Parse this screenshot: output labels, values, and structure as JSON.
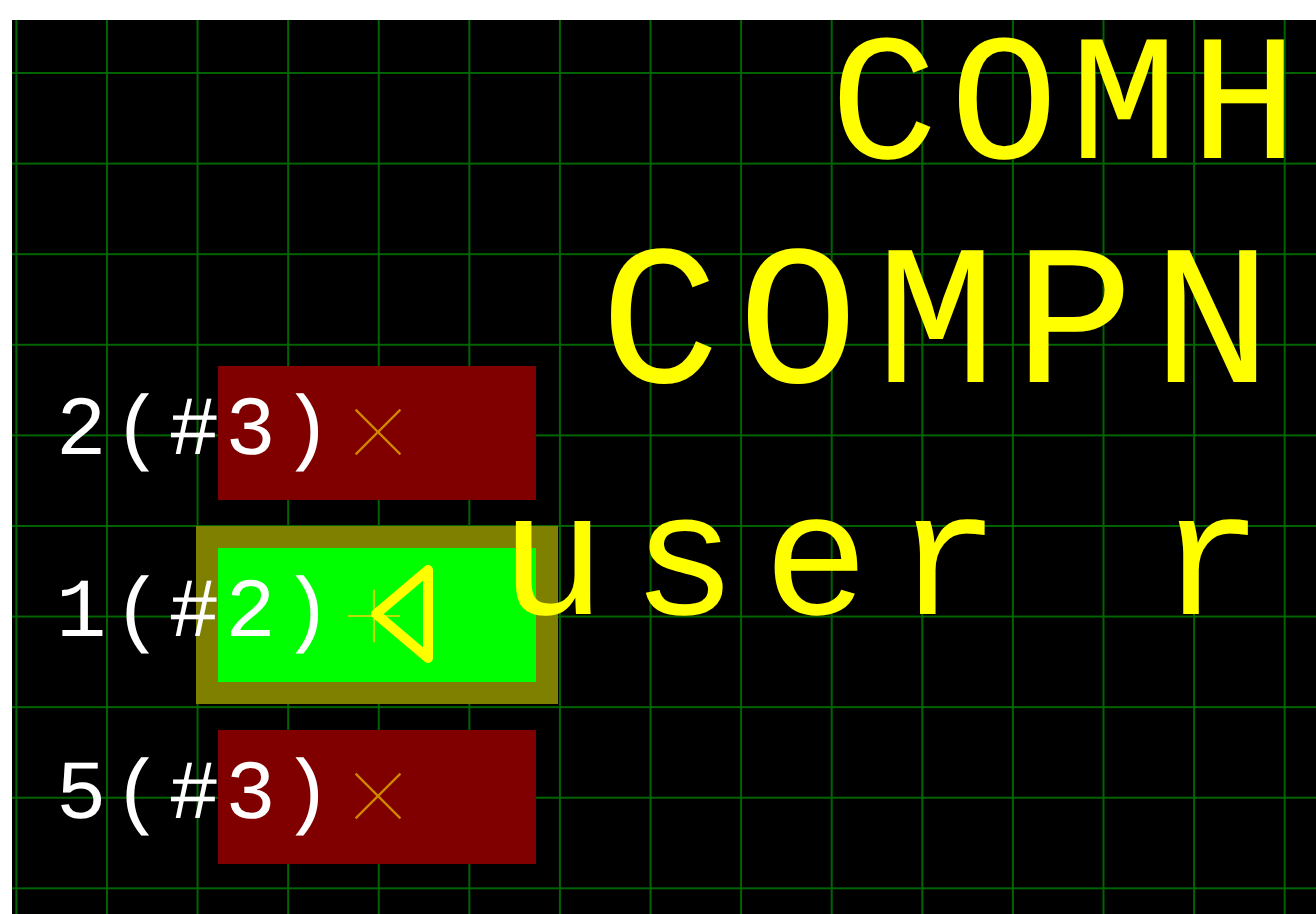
{
  "canvas": {
    "silkscreen_texts": [
      "COMH",
      "COMPN",
      "user r"
    ],
    "pads": [
      {
        "labels": [
          "2(#3)"
        ],
        "selected": false
      },
      {
        "labels": [
          "1(#2)"
        ],
        "selected": true
      },
      {
        "labels": [
          "5(#3)"
        ],
        "selected": false
      }
    ]
  }
}
